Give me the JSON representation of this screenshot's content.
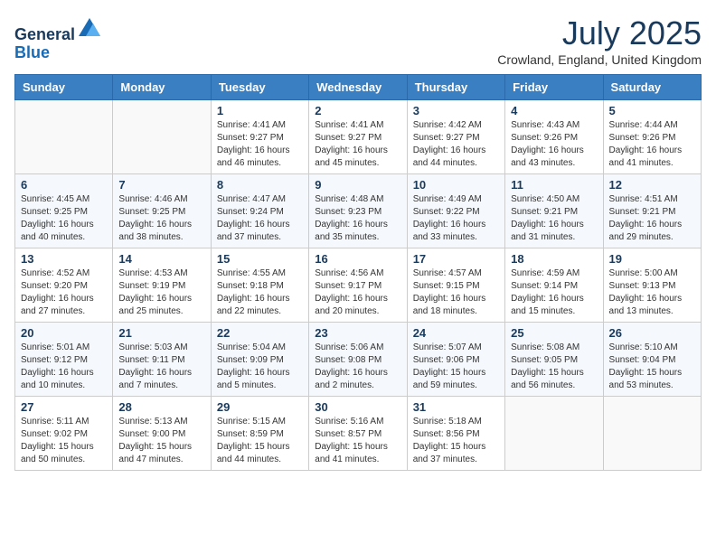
{
  "header": {
    "logo_general": "General",
    "logo_blue": "Blue",
    "month_title": "July 2025",
    "location": "Crowland, England, United Kingdom"
  },
  "columns": [
    "Sunday",
    "Monday",
    "Tuesday",
    "Wednesday",
    "Thursday",
    "Friday",
    "Saturday"
  ],
  "weeks": [
    [
      {
        "day": "",
        "sunrise": "",
        "sunset": "",
        "daylight": ""
      },
      {
        "day": "",
        "sunrise": "",
        "sunset": "",
        "daylight": ""
      },
      {
        "day": "1",
        "sunrise": "Sunrise: 4:41 AM",
        "sunset": "Sunset: 9:27 PM",
        "daylight": "Daylight: 16 hours and 46 minutes."
      },
      {
        "day": "2",
        "sunrise": "Sunrise: 4:41 AM",
        "sunset": "Sunset: 9:27 PM",
        "daylight": "Daylight: 16 hours and 45 minutes."
      },
      {
        "day": "3",
        "sunrise": "Sunrise: 4:42 AM",
        "sunset": "Sunset: 9:27 PM",
        "daylight": "Daylight: 16 hours and 44 minutes."
      },
      {
        "day": "4",
        "sunrise": "Sunrise: 4:43 AM",
        "sunset": "Sunset: 9:26 PM",
        "daylight": "Daylight: 16 hours and 43 minutes."
      },
      {
        "day": "5",
        "sunrise": "Sunrise: 4:44 AM",
        "sunset": "Sunset: 9:26 PM",
        "daylight": "Daylight: 16 hours and 41 minutes."
      }
    ],
    [
      {
        "day": "6",
        "sunrise": "Sunrise: 4:45 AM",
        "sunset": "Sunset: 9:25 PM",
        "daylight": "Daylight: 16 hours and 40 minutes."
      },
      {
        "day": "7",
        "sunrise": "Sunrise: 4:46 AM",
        "sunset": "Sunset: 9:25 PM",
        "daylight": "Daylight: 16 hours and 38 minutes."
      },
      {
        "day": "8",
        "sunrise": "Sunrise: 4:47 AM",
        "sunset": "Sunset: 9:24 PM",
        "daylight": "Daylight: 16 hours and 37 minutes."
      },
      {
        "day": "9",
        "sunrise": "Sunrise: 4:48 AM",
        "sunset": "Sunset: 9:23 PM",
        "daylight": "Daylight: 16 hours and 35 minutes."
      },
      {
        "day": "10",
        "sunrise": "Sunrise: 4:49 AM",
        "sunset": "Sunset: 9:22 PM",
        "daylight": "Daylight: 16 hours and 33 minutes."
      },
      {
        "day": "11",
        "sunrise": "Sunrise: 4:50 AM",
        "sunset": "Sunset: 9:21 PM",
        "daylight": "Daylight: 16 hours and 31 minutes."
      },
      {
        "day": "12",
        "sunrise": "Sunrise: 4:51 AM",
        "sunset": "Sunset: 9:21 PM",
        "daylight": "Daylight: 16 hours and 29 minutes."
      }
    ],
    [
      {
        "day": "13",
        "sunrise": "Sunrise: 4:52 AM",
        "sunset": "Sunset: 9:20 PM",
        "daylight": "Daylight: 16 hours and 27 minutes."
      },
      {
        "day": "14",
        "sunrise": "Sunrise: 4:53 AM",
        "sunset": "Sunset: 9:19 PM",
        "daylight": "Daylight: 16 hours and 25 minutes."
      },
      {
        "day": "15",
        "sunrise": "Sunrise: 4:55 AM",
        "sunset": "Sunset: 9:18 PM",
        "daylight": "Daylight: 16 hours and 22 minutes."
      },
      {
        "day": "16",
        "sunrise": "Sunrise: 4:56 AM",
        "sunset": "Sunset: 9:17 PM",
        "daylight": "Daylight: 16 hours and 20 minutes."
      },
      {
        "day": "17",
        "sunrise": "Sunrise: 4:57 AM",
        "sunset": "Sunset: 9:15 PM",
        "daylight": "Daylight: 16 hours and 18 minutes."
      },
      {
        "day": "18",
        "sunrise": "Sunrise: 4:59 AM",
        "sunset": "Sunset: 9:14 PM",
        "daylight": "Daylight: 16 hours and 15 minutes."
      },
      {
        "day": "19",
        "sunrise": "Sunrise: 5:00 AM",
        "sunset": "Sunset: 9:13 PM",
        "daylight": "Daylight: 16 hours and 13 minutes."
      }
    ],
    [
      {
        "day": "20",
        "sunrise": "Sunrise: 5:01 AM",
        "sunset": "Sunset: 9:12 PM",
        "daylight": "Daylight: 16 hours and 10 minutes."
      },
      {
        "day": "21",
        "sunrise": "Sunrise: 5:03 AM",
        "sunset": "Sunset: 9:11 PM",
        "daylight": "Daylight: 16 hours and 7 minutes."
      },
      {
        "day": "22",
        "sunrise": "Sunrise: 5:04 AM",
        "sunset": "Sunset: 9:09 PM",
        "daylight": "Daylight: 16 hours and 5 minutes."
      },
      {
        "day": "23",
        "sunrise": "Sunrise: 5:06 AM",
        "sunset": "Sunset: 9:08 PM",
        "daylight": "Daylight: 16 hours and 2 minutes."
      },
      {
        "day": "24",
        "sunrise": "Sunrise: 5:07 AM",
        "sunset": "Sunset: 9:06 PM",
        "daylight": "Daylight: 15 hours and 59 minutes."
      },
      {
        "day": "25",
        "sunrise": "Sunrise: 5:08 AM",
        "sunset": "Sunset: 9:05 PM",
        "daylight": "Daylight: 15 hours and 56 minutes."
      },
      {
        "day": "26",
        "sunrise": "Sunrise: 5:10 AM",
        "sunset": "Sunset: 9:04 PM",
        "daylight": "Daylight: 15 hours and 53 minutes."
      }
    ],
    [
      {
        "day": "27",
        "sunrise": "Sunrise: 5:11 AM",
        "sunset": "Sunset: 9:02 PM",
        "daylight": "Daylight: 15 hours and 50 minutes."
      },
      {
        "day": "28",
        "sunrise": "Sunrise: 5:13 AM",
        "sunset": "Sunset: 9:00 PM",
        "daylight": "Daylight: 15 hours and 47 minutes."
      },
      {
        "day": "29",
        "sunrise": "Sunrise: 5:15 AM",
        "sunset": "Sunset: 8:59 PM",
        "daylight": "Daylight: 15 hours and 44 minutes."
      },
      {
        "day": "30",
        "sunrise": "Sunrise: 5:16 AM",
        "sunset": "Sunset: 8:57 PM",
        "daylight": "Daylight: 15 hours and 41 minutes."
      },
      {
        "day": "31",
        "sunrise": "Sunrise: 5:18 AM",
        "sunset": "Sunset: 8:56 PM",
        "daylight": "Daylight: 15 hours and 37 minutes."
      },
      {
        "day": "",
        "sunrise": "",
        "sunset": "",
        "daylight": ""
      },
      {
        "day": "",
        "sunrise": "",
        "sunset": "",
        "daylight": ""
      }
    ]
  ]
}
